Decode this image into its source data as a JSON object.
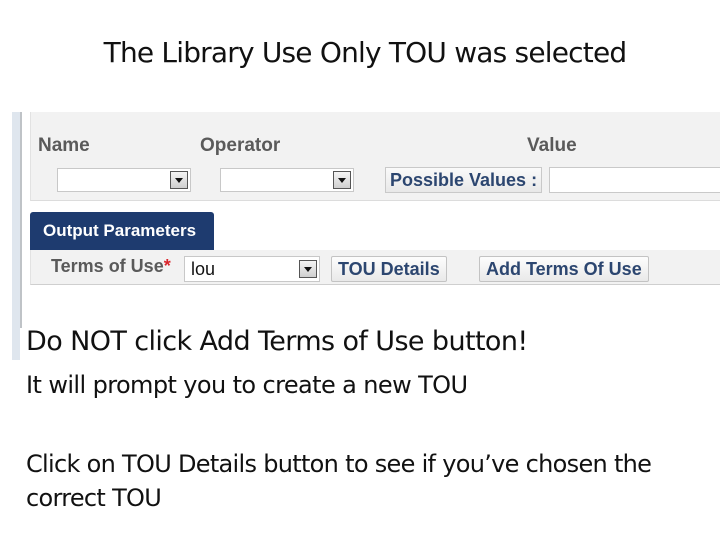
{
  "slide": {
    "title": "The Library Use Only TOU was selected",
    "notes": {
      "warning": "Do NOT click Add Terms of Use button!",
      "warning_detail": "It will prompt you to create a new TOU",
      "instruction": "Click on TOU Details button to see if you’ve chosen the correct TOU"
    }
  },
  "filter_panel": {
    "name_label": "Name",
    "operator_label": "Operator",
    "value_label": "Value",
    "name_select_value": "",
    "operator_select_value": "",
    "possible_values_label": "Possible Values :",
    "value_input": ""
  },
  "output_parameters": {
    "tab_label": "Output Parameters",
    "terms_of_use_label": "Terms of Use",
    "required_marker": "*",
    "terms_of_use_value": "lou",
    "tou_details_button": "TOU Details",
    "add_terms_button": "Add Terms Of Use"
  },
  "colors": {
    "tab_bg": "#1e3b6f",
    "button_text": "#2c4670",
    "required": "#d9242b"
  }
}
